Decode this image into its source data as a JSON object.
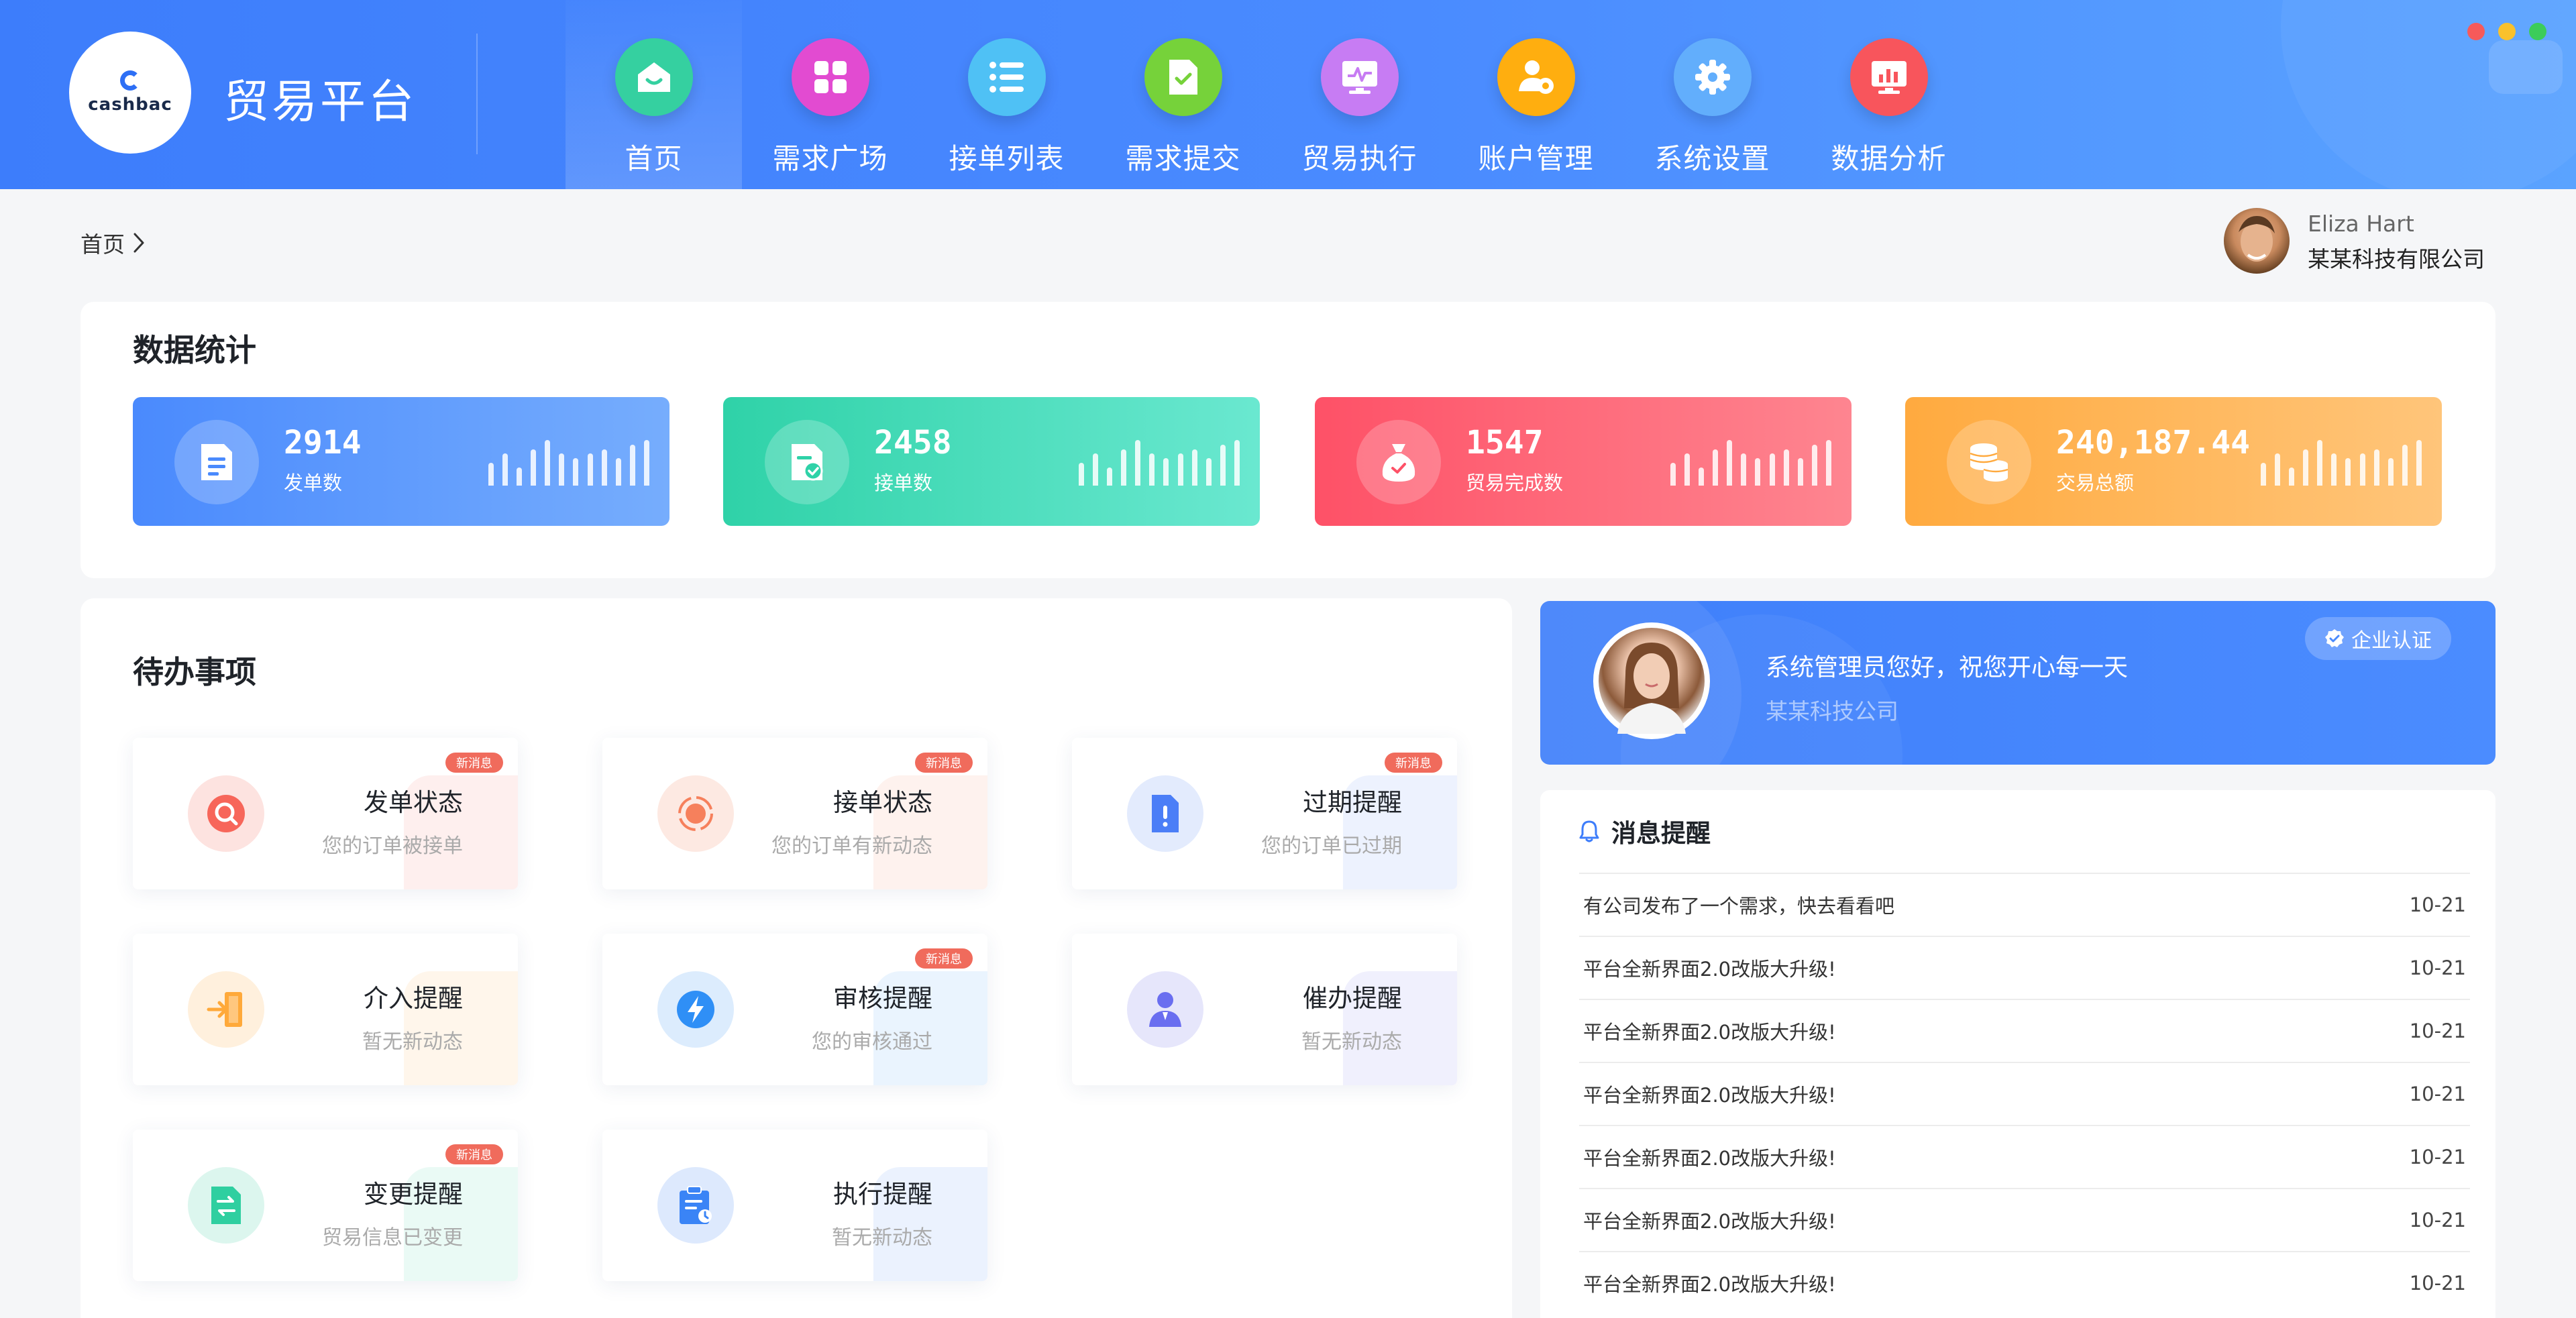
{
  "app": {
    "logo_text": "cashbac",
    "title": "贸易平台"
  },
  "nav": [
    {
      "label": "首页",
      "icon": "home-icon",
      "color": "#35d0a0",
      "active": true
    },
    {
      "label": "需求广场",
      "icon": "grid-icon",
      "color": "#e24bd1"
    },
    {
      "label": "接单列表",
      "icon": "list-icon",
      "color": "#4fc1f5"
    },
    {
      "label": "需求提交",
      "icon": "document-check-icon",
      "color": "#76d23a"
    },
    {
      "label": "贸易执行",
      "icon": "monitor-chart-icon",
      "color": "#c77cf3"
    },
    {
      "label": "账户管理",
      "icon": "user-settings-icon",
      "color": "#ffae0f"
    },
    {
      "label": "系统设置",
      "icon": "gear-icon",
      "color": "#62aefc"
    },
    {
      "label": "数据分析",
      "icon": "analytics-icon",
      "color": "#f8555c"
    }
  ],
  "window_controls": {
    "colors": [
      "#f65a5a",
      "#f9c12c",
      "#3ccc5a"
    ]
  },
  "breadcrumb": {
    "home": "首页"
  },
  "user": {
    "name": "Eliza Hart",
    "company": "某某科技有限公司"
  },
  "stats": {
    "title": "数据统计",
    "cards": [
      {
        "value": "2914",
        "label": "发单数",
        "icon": "document-icon",
        "gradient": [
          "#4a8afd",
          "#76adfd"
        ],
        "bars": [
          0.5,
          0.7,
          0.4,
          0.8,
          1.0,
          0.7,
          0.6,
          0.7,
          0.8,
          0.6,
          0.9,
          1.0
        ]
      },
      {
        "value": "2458",
        "label": "接单数",
        "icon": "document-check-icon",
        "gradient": [
          "#2fd2a8",
          "#6ae8d0"
        ],
        "bars": [
          0.5,
          0.7,
          0.4,
          0.8,
          1.0,
          0.7,
          0.6,
          0.7,
          0.8,
          0.6,
          0.9,
          1.0
        ]
      },
      {
        "value": "1547",
        "label": "贸易完成数",
        "icon": "money-bag-icon",
        "gradient": [
          "#fe5167",
          "#fe8590"
        ],
        "bars": [
          0.5,
          0.7,
          0.4,
          0.8,
          1.0,
          0.7,
          0.6,
          0.7,
          0.8,
          0.6,
          0.9,
          1.0
        ]
      },
      {
        "value": "240,187.44",
        "label": "交易总额",
        "icon": "coins-icon",
        "gradient": [
          "#ffaa3f",
          "#ffc57a"
        ],
        "bars": [
          0.5,
          0.7,
          0.4,
          0.8,
          1.0,
          0.7,
          0.6,
          0.7,
          0.8,
          0.6,
          0.9,
          1.0
        ]
      }
    ]
  },
  "todo": {
    "title": "待办事项",
    "items": [
      {
        "title": "发单状态",
        "subtitle": "您的订单被接单",
        "badge": "新消息",
        "icon": "search-icon",
        "color": "#f7665a",
        "tint": "#fde3e0"
      },
      {
        "title": "接单状态",
        "subtitle": "您的订单有新动态",
        "badge": "新消息",
        "icon": "target-icon",
        "color": "#f6805c",
        "tint": "#fde9e2"
      },
      {
        "title": "过期提醒",
        "subtitle": "您的订单已过期",
        "badge": "新消息",
        "icon": "alert-file-icon",
        "color": "#4b7ef7",
        "tint": "#e3ebfd"
      },
      {
        "title": "介入提醒",
        "subtitle": "暂无新动态",
        "badge": "",
        "icon": "door-icon",
        "color": "#ffa93a",
        "tint": "#fff0dd"
      },
      {
        "title": "审核提醒",
        "subtitle": "您的审核通过",
        "badge": "新消息",
        "icon": "lightning-icon",
        "color": "#2f8ff6",
        "tint": "#dcecfd"
      },
      {
        "title": "催办提醒",
        "subtitle": "暂无新动态",
        "badge": "",
        "icon": "person-icon",
        "color": "#6a6ef0",
        "tint": "#e6e6fb"
      },
      {
        "title": "变更提醒",
        "subtitle": "贸易信息已变更",
        "badge": "新消息",
        "icon": "swap-icon",
        "color": "#2fcfa0",
        "tint": "#dcf6ee"
      },
      {
        "title": "执行提醒",
        "subtitle": "暂无新动态",
        "badge": "",
        "icon": "clipboard-icon",
        "color": "#3a84f6",
        "tint": "#dde9fd"
      }
    ]
  },
  "welcome": {
    "message": "系统管理员您好，祝您开心每一天",
    "company": "某某科技公司",
    "badge": "企业认证"
  },
  "messages": {
    "title": "消息提醒",
    "items": [
      {
        "text": "有公司发布了一个需求，快去看看吧",
        "date": "10-21"
      },
      {
        "text": "平台全新界面2.0改版大升级!",
        "date": "10-21"
      },
      {
        "text": "平台全新界面2.0改版大升级!",
        "date": "10-21"
      },
      {
        "text": "平台全新界面2.0改版大升级!",
        "date": "10-21"
      },
      {
        "text": "平台全新界面2.0改版大升级!",
        "date": "10-21"
      },
      {
        "text": "平台全新界面2.0改版大升级!",
        "date": "10-21"
      },
      {
        "text": "平台全新界面2.0改版大升级!",
        "date": "10-21"
      }
    ]
  }
}
